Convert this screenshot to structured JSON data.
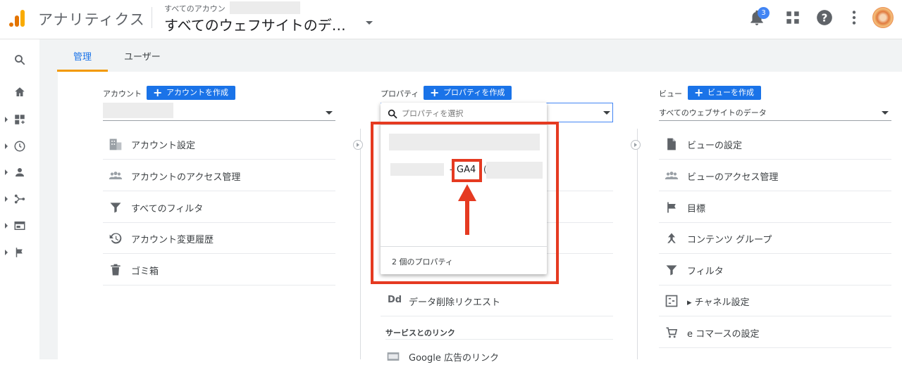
{
  "topbar": {
    "app_name": "アナリティクス",
    "account_sub": "すべてのアカウン",
    "account_title": "すべてのウェフサイトのデ…",
    "notification_count": "3",
    "icons": [
      "bell-icon",
      "apps-grid-icon",
      "help-icon",
      "more-vert-icon"
    ]
  },
  "rail": {
    "items": [
      "search-icon",
      "home-icon",
      "customization-icon",
      "realtime-icon",
      "audience-icon",
      "acquisition-icon",
      "behavior-icon",
      "conversions-icon"
    ]
  },
  "tabs": [
    {
      "label": "管理",
      "active": true
    },
    {
      "label": "ユーザー",
      "active": false
    }
  ],
  "account": {
    "label": "アカウント",
    "create_label": "アカウントを作成",
    "items": [
      {
        "icon": "building-icon",
        "label": "アカウント設定"
      },
      {
        "icon": "people-icon",
        "label": "アカウントのアクセス管理"
      },
      {
        "icon": "filter-icon",
        "label": "すべてのフィルタ"
      },
      {
        "icon": "history-icon",
        "label": "アカウント変更履歴"
      },
      {
        "icon": "trash-icon",
        "label": "ゴミ箱"
      }
    ]
  },
  "property": {
    "label": "プロパティ",
    "create_label": "プロパティを作成",
    "search_placeholder": "プロパティを選択",
    "option_ga4_text": "GA4",
    "option_prefix": "-",
    "option_suffix": "(",
    "count_text": "2 個のプロパティ",
    "below_items": [
      {
        "icon": "dd-icon",
        "icon_text": "Dd",
        "label": "データ削除リクエスト"
      }
    ],
    "section_links": "サービスとのリンク",
    "link_items": [
      {
        "icon": "ads-icon",
        "label": "Google 広告のリンク"
      }
    ]
  },
  "view": {
    "label": "ビュー",
    "create_label": "ビューを作成",
    "selected": "すべてのウェブサイトのデータ",
    "items": [
      {
        "icon": "document-icon",
        "label": "ビューの設定"
      },
      {
        "icon": "people-icon",
        "label": "ビューのアクセス管理"
      },
      {
        "icon": "flag-icon",
        "label": "目標"
      },
      {
        "icon": "content-group-icon",
        "label": "コンテンツ グループ"
      },
      {
        "icon": "filter-icon",
        "label": "フィルタ"
      },
      {
        "icon": "channel-icon",
        "label": "▸ チャネル設定"
      },
      {
        "icon": "cart-icon",
        "label": "e コマースの設定"
      }
    ]
  },
  "colors": {
    "accent": "#1a73e8",
    "tab_active": "#f29900",
    "highlight": "#e53a21"
  }
}
